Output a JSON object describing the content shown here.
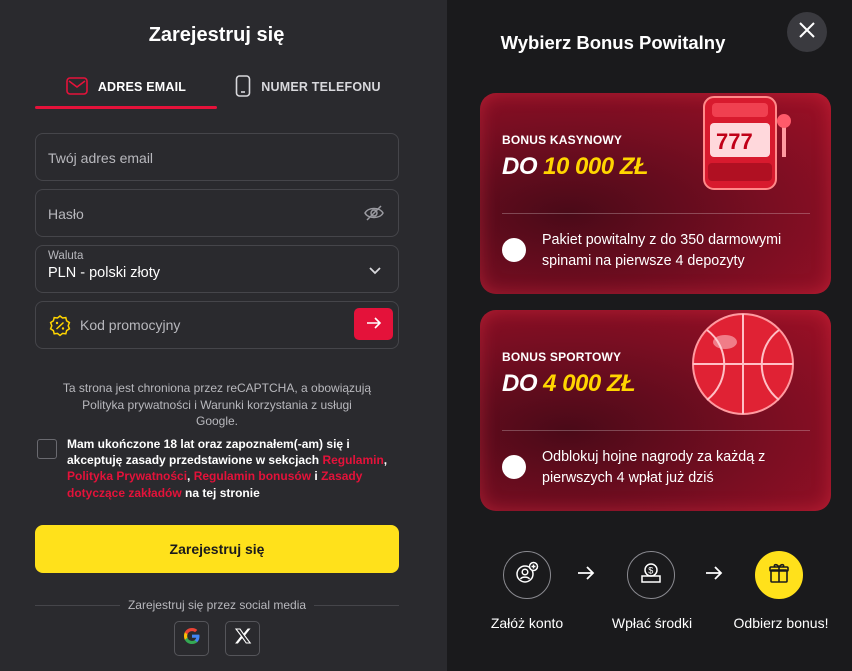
{
  "left": {
    "title": "Zarejestruj się",
    "tabs": [
      {
        "label": "ADRES EMAIL",
        "icon": "mail-icon",
        "active": true
      },
      {
        "label": "NUMER TELEFONU",
        "icon": "phone-icon",
        "active": false
      }
    ],
    "email_placeholder": "Twój adres email",
    "password_placeholder": "Hasło",
    "currency": {
      "label": "Waluta",
      "value": "PLN - polski złoty"
    },
    "promo_placeholder": "Kod promocyjny",
    "captcha_text": "Ta strona jest chroniona przez reCAPTCHA, a obowiązują Polityka prywatności i Warunki korzystania z usługi Google.",
    "terms": {
      "t1": "Mam ukończone 18 lat oraz zapoznałem(-am) się i akceptuję zasady przedstawione w sekcjach ",
      "l1": "Regulamin",
      "t2": ", ",
      "l2": "Polityka Prywatności",
      "t3": ", ",
      "l3": "Regulamin bonusów",
      "t4": " i ",
      "l4": "Zasady dotyczące zakładów",
      "t5": " na tej stronie"
    },
    "register_button": "Zarejestruj się",
    "social_label": "Zarejestruj się przez social media"
  },
  "right": {
    "title": "Wybierz Bonus Powitalny",
    "cards": [
      {
        "label": "BONUS KASYNOWY",
        "amount_prefix": "DO ",
        "amount": "10 000 ZŁ",
        "desc": "Pakiet powitalny z do 350 darmowymi spinami na pierwsze 4 depozyty"
      },
      {
        "label": "BONUS SPORTOWY",
        "amount_prefix": "DO ",
        "amount": "4 000 ZŁ",
        "desc": "Odblokuj hojne nagrody za każdą z pierwszych 4 wpłat już dziś"
      }
    ],
    "steps": [
      "Załóż konto",
      "Wpłać środki",
      "Odbierz bonus!"
    ]
  },
  "colors": {
    "accent": "#e4123a",
    "yellow": "#ffe11b",
    "panel": "#2a2a2e",
    "bg": "#1a1a1c"
  }
}
